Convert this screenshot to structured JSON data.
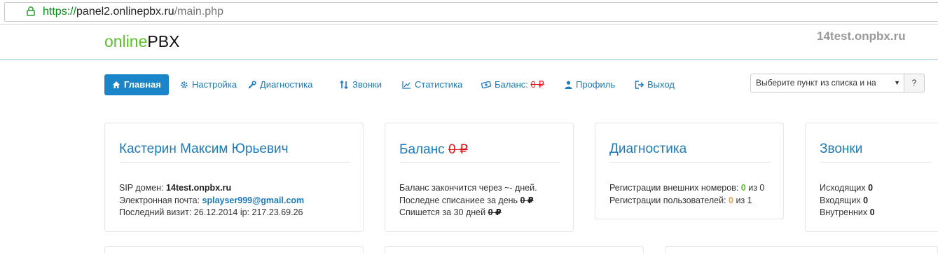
{
  "browser": {
    "url_scheme": "https://",
    "url_host": "panel2.onlinepbx.ru",
    "url_path": "/main.php"
  },
  "header": {
    "logo_part1": "online",
    "logo_part2": "PBX",
    "domain": "14test.onpbx.ru"
  },
  "nav": {
    "items": [
      {
        "label": "Главная",
        "icon": "home-icon"
      },
      {
        "label": "Настройка",
        "icon": "gear-icon"
      },
      {
        "label": "Диагностика",
        "icon": "wrench-icon"
      },
      {
        "label": "Звонки",
        "icon": "up-down-arrows-icon"
      },
      {
        "label": "Статистика",
        "icon": "line-chart-icon"
      },
      {
        "label": "Баланс:",
        "value": "0 ₽",
        "icon": "money-icon"
      },
      {
        "label": "Профиль",
        "icon": "user-icon"
      },
      {
        "label": "Выход",
        "icon": "sign-out-icon"
      }
    ],
    "select_placeholder": "Выберите пункт из списка и на",
    "help_label": "?"
  },
  "cards": {
    "profile": {
      "title": "Кастерин Максим Юрьевич",
      "sip_label": "SIP домен:",
      "sip_value": "14test.onpbx.ru",
      "email_label": "Электронная почта:",
      "email_value": "splayser999@gmail.com",
      "visit_label": "Последний визит: 26.12.2014 ip: 217.23.69.26"
    },
    "balance": {
      "title": "Баланс",
      "title_value": "0 ₽",
      "line1": "Баланс закончится через ~- дней.",
      "line2_label": "Последне списаниее за день",
      "line2_value": "0 ₽",
      "line3_label": "Спишется за 30 дней",
      "line3_value": "0 ₽"
    },
    "diagnostics": {
      "title": "Диагностика",
      "line1_label": "Регистрации внешних номеров:",
      "line1_value": "0",
      "line1_of": "из 0",
      "line2_label": "Регистрации пользователей:",
      "line2_value": "0",
      "line2_of": "из 1"
    },
    "calls": {
      "title": "Звонки",
      "outgoing_label": "Исходящих",
      "outgoing_value": "0",
      "incoming_label": "Входящих",
      "incoming_value": "0",
      "internal_label": "Внутренних",
      "internal_value": "0"
    }
  },
  "colors": {
    "accent": "#1a7bbd",
    "active_tab": "#1a85c8",
    "logo_green": "#5cc02d",
    "currency_red": "#e0161b",
    "warning_orange": "#f0a030"
  }
}
